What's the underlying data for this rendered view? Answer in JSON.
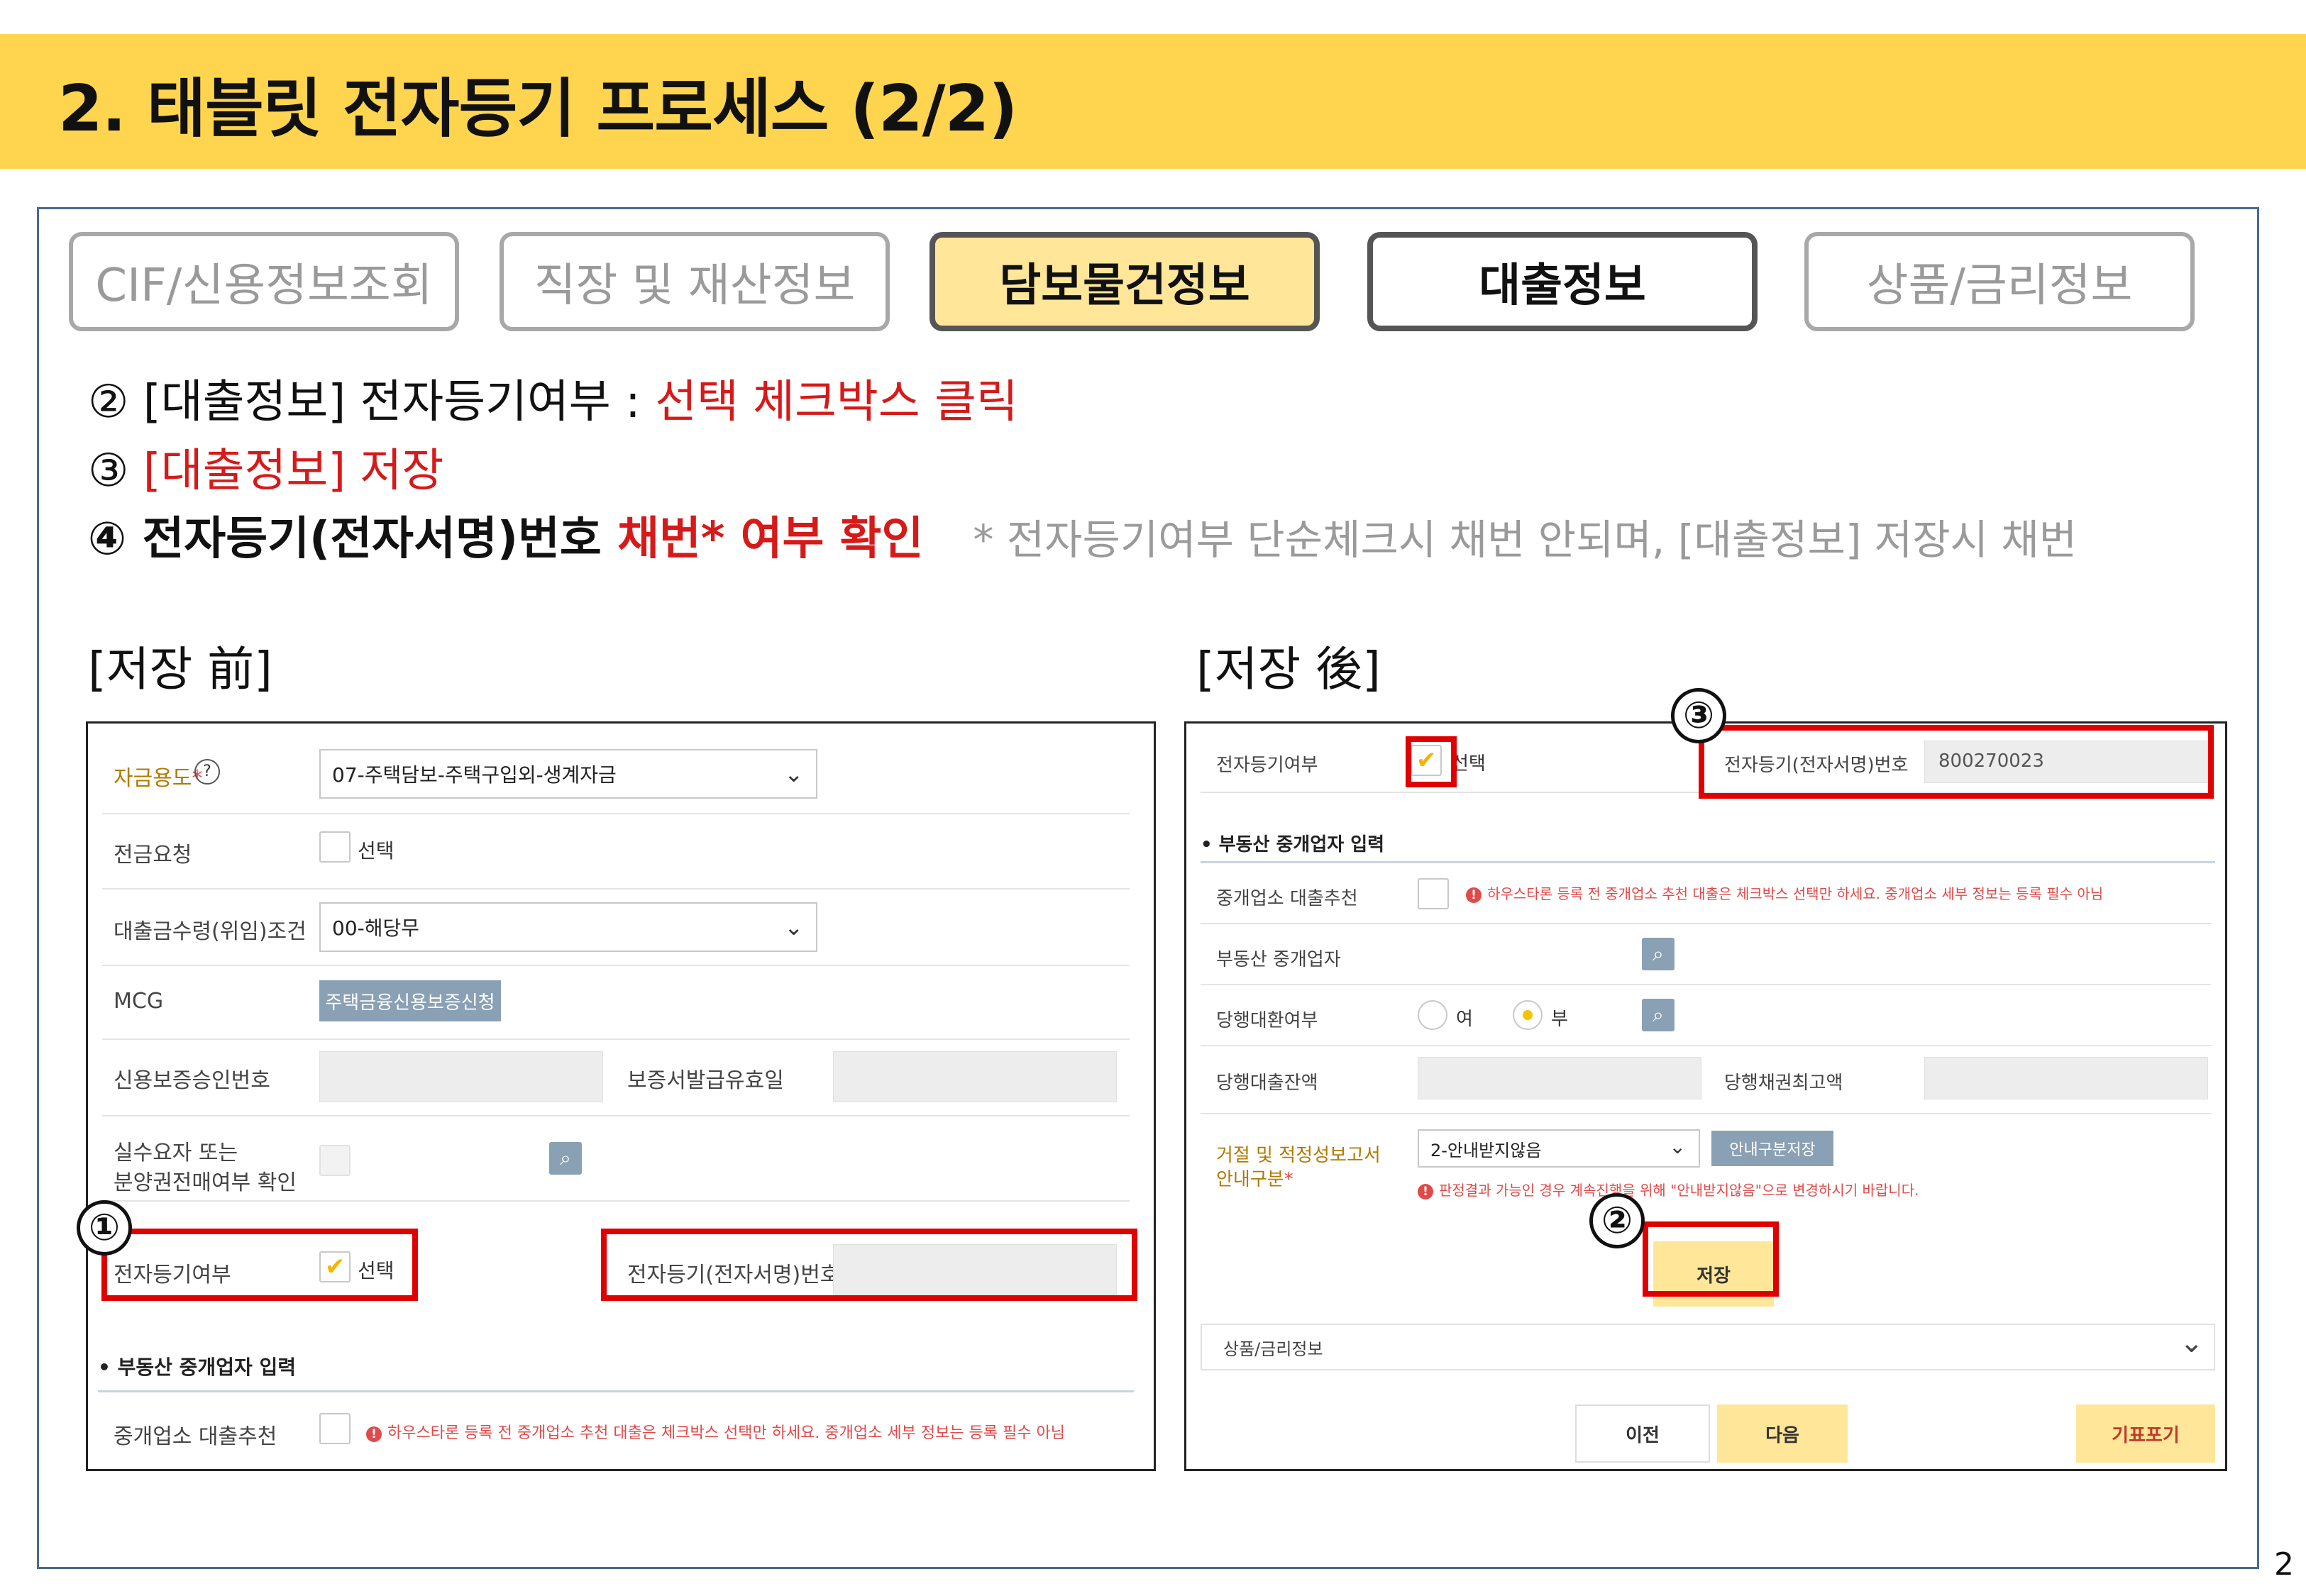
{
  "header": {
    "title": "2. 태블릿 전자등기 프로세스 (2/2)"
  },
  "tabs": [
    {
      "label": "CIF/신용정보조회",
      "state": "inactive"
    },
    {
      "label": "직장 및 재산정보",
      "state": "inactive"
    },
    {
      "label": "담보물건정보",
      "state": "active"
    },
    {
      "label": "대출정보",
      "state": "selected"
    },
    {
      "label": "상품/금리정보",
      "state": "inactive"
    }
  ],
  "steps": {
    "s2_prefix": "② [대출정보] 전자등기여부 : ",
    "s2_red": "선택 체크박스 클릭",
    "s3_prefix": "③ ",
    "s3_red": "[대출정보] 저장",
    "s4_prefix": "④ 전자등기(전자서명)번호 ",
    "s4_red": "채번* 여부 확인",
    "s4_note": "* 전자등기여부 단순체크시 채번 안되며, [대출정보] 저장시 채번"
  },
  "before": {
    "caption": "[저장 前]",
    "fund_use_label": "자금용도",
    "fund_use_req": "*",
    "help_icon": "?",
    "fund_use_value": "07-주택담보-주택구입외-생계자금",
    "transfer_label": "전금요청",
    "transfer_check": "선택",
    "receipt_label": "대출금수령(위임)조건",
    "receipt_value": "00-해당무",
    "mcg_label": "MCG",
    "mcg_button": "주택금융신용보증신청",
    "credit_label": "신용보증승인번호",
    "guarantee_label": "보증서발급유효일",
    "buyer_label_1": "실수요자 또는",
    "buyer_label_2": "분양권전매여부 확인",
    "eregi_label": "전자등기여부",
    "eregi_check": "선택",
    "eregi_no_label": "전자등기(전자서명)번호",
    "realtor_section": "• 부동산 중개업자 입력",
    "broker_rec_label": "중개업소 대출추천",
    "broker_warn": "하우스타론 등록 전 중개업소 추천 대출은 체크박스 선택만 하세요. 중개업소 세부 정보는 등록 필수 아님",
    "marker": "①"
  },
  "after": {
    "caption": "[저장 後]",
    "eregi_label": "전자등기여부",
    "eregi_check": "선택",
    "eregi_no_label": "전자등기(전자서명)번호",
    "eregi_no_value": "800270023",
    "realtor_section": "• 부동산 중개업자 입력",
    "broker_rec_label": "중개업소 대출추천",
    "broker_warn": "하우스타론 등록 전 중개업소 추천 대출은 체크박스 선택만 하세요. 중개업소 세부 정보는 등록 필수 아님",
    "realtor_label": "부동산 중개업자",
    "refinance_label": "당행대환여부",
    "radio_yes": "여",
    "radio_no": "부",
    "loan_balance_label": "당행대출잔액",
    "max_claim_label": "당행채권최고액",
    "reject_label_1": "거절 및 적정성보고서",
    "reject_label_2": "안내구분",
    "reject_req": "*",
    "reject_value": "2-안내받지않음",
    "guide_save_button": "안내구분저장",
    "reject_warn": "판정결과 가능인 경우 계속진행을 위해 \"안내받지않음\"으로 변경하시기 바랍니다.",
    "save_button": "저장",
    "product_section": "상품/금리정보",
    "prev_button": "이전",
    "next_button": "다음",
    "cancel_button": "기표포기",
    "marker_2": "②",
    "marker_3": "③"
  },
  "page_number": "2",
  "colors": {
    "header_bg": "#ffd54f",
    "highlight": "#e00000",
    "accent_yellow": "#ffe699"
  }
}
